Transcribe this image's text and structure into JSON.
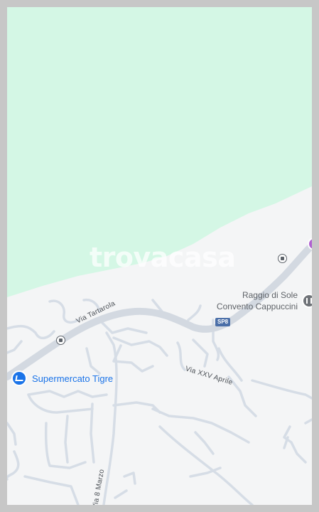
{
  "colors": {
    "water": "#d4f7e5",
    "land": "#f4f5f6",
    "major_road": "#d3d9e1",
    "minor_road": "#d6dde6",
    "frame": "#c7c7c7"
  },
  "watermark": "trovacasa",
  "roads": {
    "via_tartarola": "Via Tartarola",
    "via_xxv_aprile": "Via XXV Aprile",
    "via_8_marzo": "Via 8 Marzo",
    "route_shield": "SP8"
  },
  "pois": {
    "raggio_di_sole": "Raggio di Sole",
    "convento_cappuccini": "Convento Cappuccini",
    "supermercato": "Supermercato Tigre"
  },
  "icons": {
    "bus_stops": [
      "bus-stop-icon",
      "bus-stop-icon"
    ],
    "supermarket": "shopping-cart-icon",
    "museum": "museum-icon",
    "edge_poi": "place-icon"
  }
}
